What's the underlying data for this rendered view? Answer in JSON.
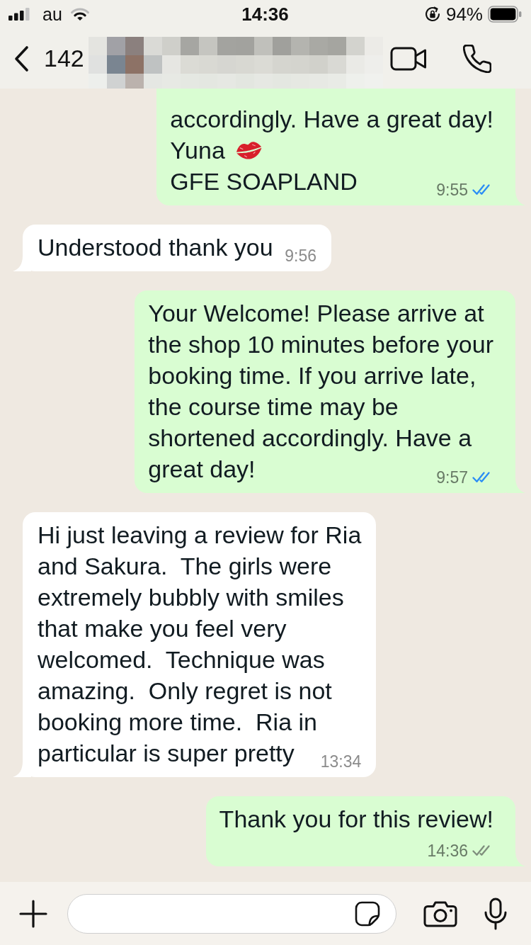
{
  "status_bar": {
    "carrier": "au",
    "time": "14:36",
    "battery": "94%"
  },
  "header": {
    "title": "142"
  },
  "messages": [
    {
      "kind": "outgoing",
      "continued": true,
      "lines": [
        {
          "text": "accordingly. Have a great day!",
          "emoji": false
        },
        {
          "text": "Yuna",
          "emoji": true
        },
        {
          "text": "GFE SOAPLAND",
          "emoji": false
        }
      ],
      "time": "9:55",
      "read": true
    },
    {
      "kind": "incoming",
      "continued": false,
      "lines": [
        {
          "text": "Understood thank you",
          "emoji": false
        }
      ],
      "time": "9:56"
    },
    {
      "kind": "outgoing",
      "continued": false,
      "lines": [
        {
          "text": "Your Welcome! Please arrive at",
          "emoji": false
        },
        {
          "text": "the shop 10 minutes before your",
          "emoji": false
        },
        {
          "text": "booking time. If you arrive late,",
          "emoji": false
        },
        {
          "text": "the course time may be",
          "emoji": false
        },
        {
          "text": "shortened accordingly. Have a",
          "emoji": false
        },
        {
          "text": "great day!",
          "emoji": false
        }
      ],
      "time": "9:57",
      "read": true
    },
    {
      "kind": "incoming",
      "continued": false,
      "lines": [
        {
          "text": "Hi just leaving a review for Ria",
          "emoji": false
        },
        {
          "text": "and Sakura.  The girls were",
          "emoji": false
        },
        {
          "text": "extremely bubbly with smiles",
          "emoji": false
        },
        {
          "text": "that make you feel very",
          "emoji": false
        },
        {
          "text": "welcomed.  Technique was",
          "emoji": false
        },
        {
          "text": "amazing.  Only regret is not",
          "emoji": false
        },
        {
          "text": "booking more time.  Ria in",
          "emoji": false
        },
        {
          "text": "particular is super pretty",
          "emoji": false
        }
      ],
      "time": "13:34"
    },
    {
      "kind": "outgoing",
      "continued": false,
      "lines": [
        {
          "text": "Thank you for this review!",
          "emoji": false
        }
      ],
      "time": "14:36",
      "read": false
    }
  ]
}
